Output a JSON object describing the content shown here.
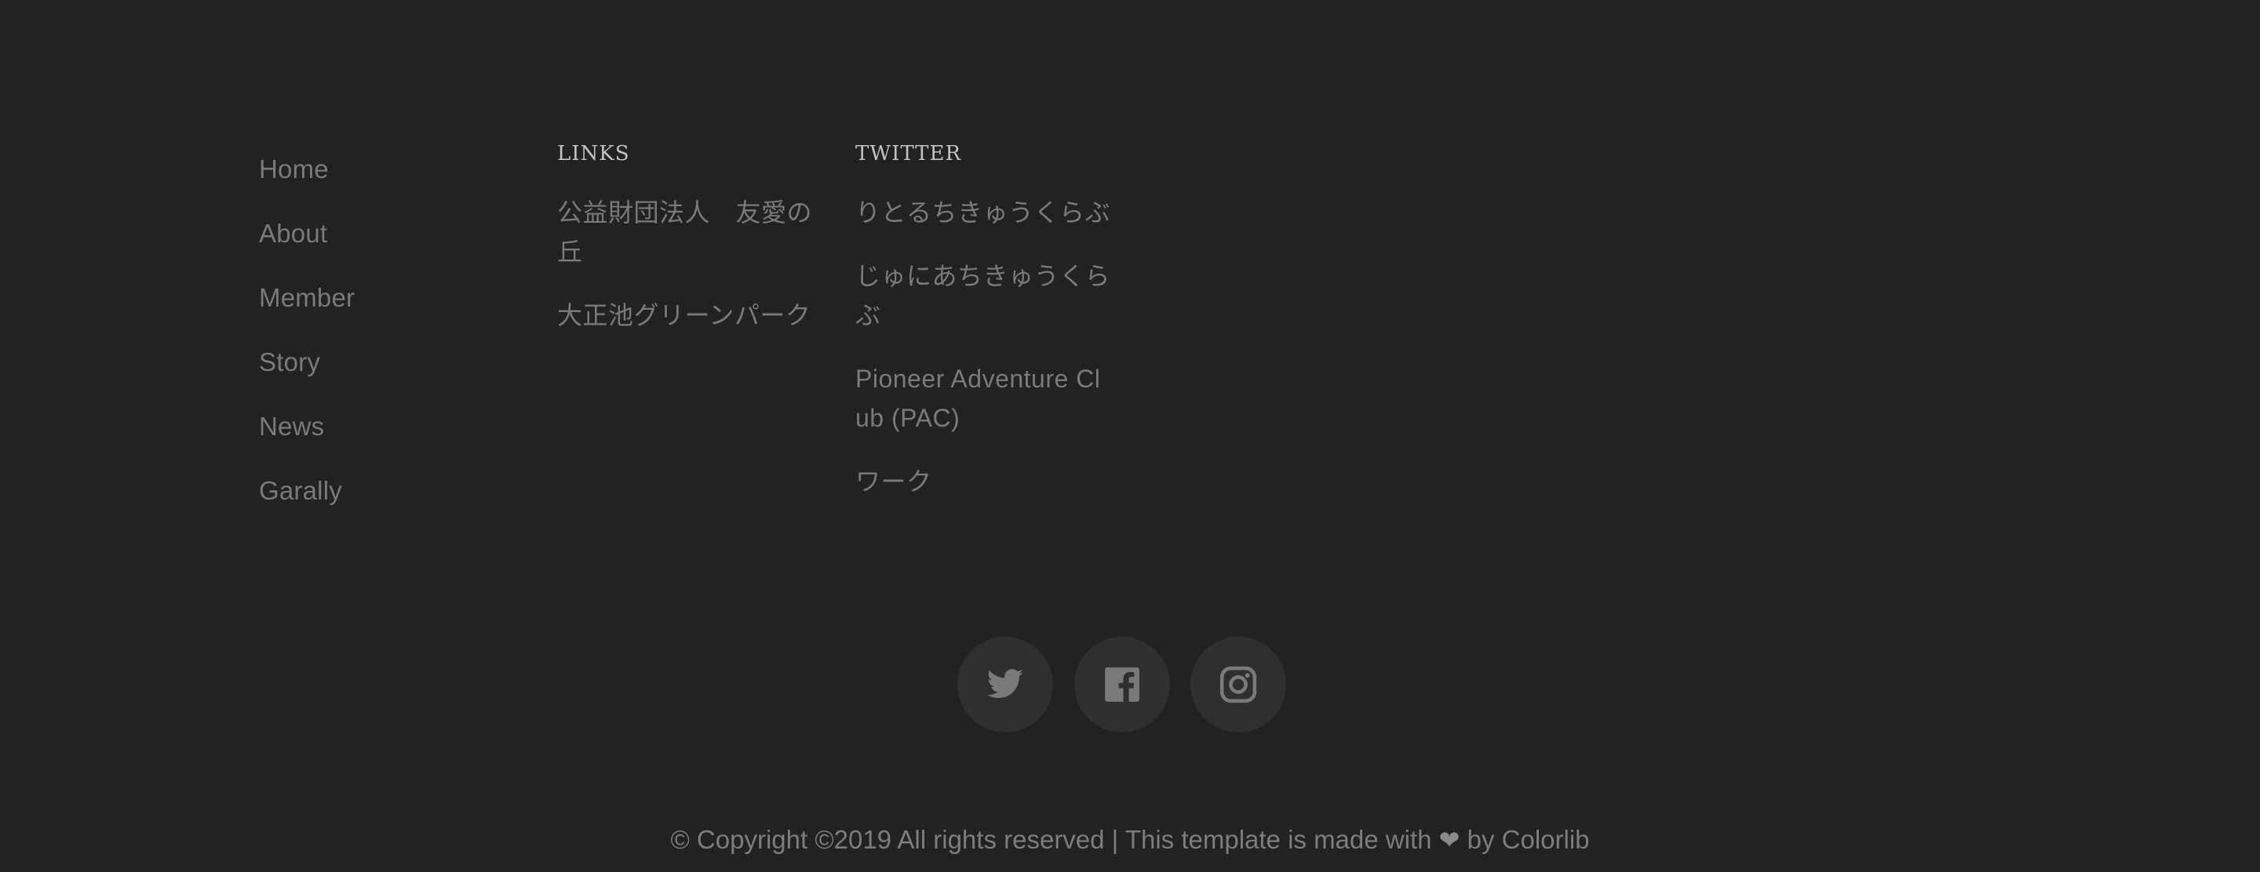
{
  "nav": {
    "items": [
      {
        "label": "Home"
      },
      {
        "label": "About"
      },
      {
        "label": "Member"
      },
      {
        "label": "Story"
      },
      {
        "label": "News"
      },
      {
        "label": "Garally"
      }
    ]
  },
  "links": {
    "heading": "LINKS",
    "items": [
      {
        "label": "公益財団法人　友愛の丘"
      },
      {
        "label": "大正池グリーンパーク"
      }
    ]
  },
  "twitter": {
    "heading": "TWITTER",
    "items": [
      {
        "label": "りとるちきゅうくらぶ"
      },
      {
        "label": "じゅにあちきゅうくらぶ"
      },
      {
        "label": "Pioneer Adventure Club (PAC)"
      },
      {
        "label": "ワーク"
      }
    ]
  },
  "social": {
    "buttons": [
      {
        "icon": "twitter-icon"
      },
      {
        "icon": "facebook-icon"
      },
      {
        "icon": "instagram-icon"
      }
    ],
    "background": "#2f2f2f",
    "icon_color": "#7a7a7a"
  },
  "copyright": {
    "before": "© Copyright ©2019 All rights reserved | This template is made with",
    "heart": "❤",
    "after": "by Colorlib"
  },
  "colors": {
    "background": "#222222",
    "text": "#7a7a7a",
    "heading": "#c2c2c2"
  }
}
